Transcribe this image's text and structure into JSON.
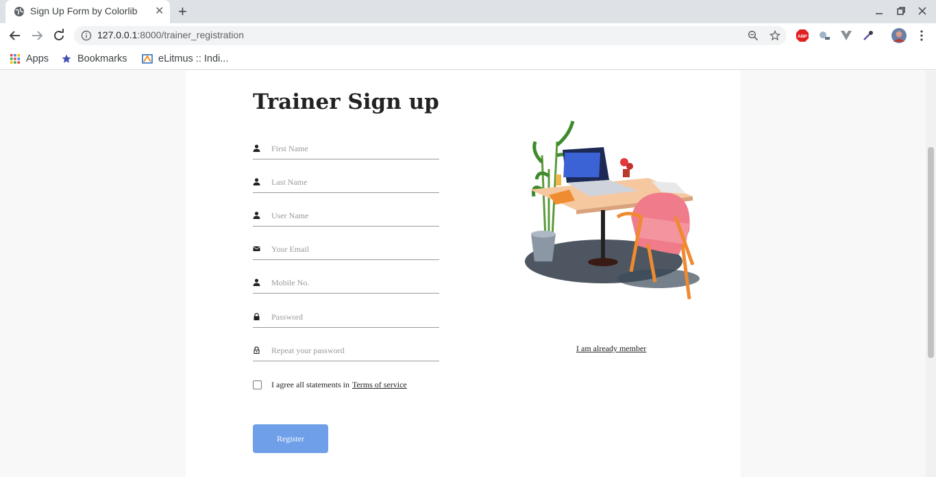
{
  "browser": {
    "tab_title": "Sign Up Form by Colorlib",
    "tab_close": "✕",
    "new_tab": "+",
    "url_host": "127.0.0.1",
    "url_path": ":8000/trainer_registration",
    "bookmarks": [
      {
        "label": "Apps"
      },
      {
        "label": "Bookmarks"
      },
      {
        "label": "eLitmus :: Indi..."
      }
    ]
  },
  "form": {
    "title": "Trainer Sign up",
    "fields": [
      {
        "placeholder": "First Name",
        "icon": "person-icon"
      },
      {
        "placeholder": "Last Name",
        "icon": "person-icon"
      },
      {
        "placeholder": "User Name",
        "icon": "person-icon"
      },
      {
        "placeholder": "Your Email",
        "icon": "email-icon"
      },
      {
        "placeholder": "Mobile No.",
        "icon": "person-icon"
      },
      {
        "placeholder": "Password",
        "icon": "lock-icon"
      },
      {
        "placeholder": "Repeat your password",
        "icon": "lock-open-icon"
      }
    ],
    "agree_text": "I agree all statements in",
    "terms_link": "Terms of service",
    "register_label": "Register",
    "member_link": "I am already member"
  },
  "colors": {
    "register_button": "#6e9fe8",
    "page_bg": "#f8f8f8",
    "card_bg": "#ffffff"
  }
}
